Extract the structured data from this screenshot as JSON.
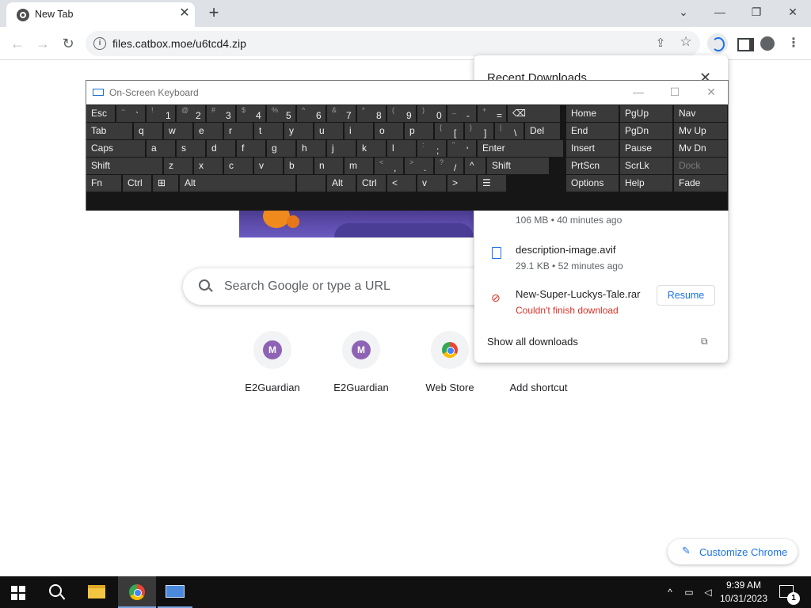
{
  "tab": {
    "title": "New Tab",
    "close_glyph": "✕"
  },
  "newtab_glyph": "+",
  "window_controls": {
    "tab_search": "⌄",
    "minimize": "—",
    "restore": "❐",
    "close": "✕"
  },
  "toolbar": {
    "back_glyph": "←",
    "forward_glyph": "→",
    "reload_glyph": "↻",
    "url": "files.catbox.moe/u6tcd4.zip",
    "info_glyph": "i",
    "share_glyph": "⇪",
    "star_glyph": "☆",
    "menu_glyph": "⋮"
  },
  "ntp": {
    "search_placeholder": "Search Google or type a URL",
    "shortcuts": [
      {
        "letter": "M",
        "label": "E2Guardian"
      },
      {
        "letter": "M",
        "label": "E2Guardian"
      },
      {
        "label": "Web Store"
      },
      {
        "label": "Add shortcut"
      }
    ],
    "customize_label": "Customize Chrome",
    "pencil_glyph": "✎"
  },
  "downloads": {
    "title": "Recent Downloads",
    "close_glyph": "✕",
    "items": [
      {
        "name": "",
        "meta": "106 MB • 40 minutes ago"
      },
      {
        "name": "description-image.avif",
        "meta": "29.1 KB • 52 minutes ago"
      },
      {
        "name": "New-Super-Luckys-Tale.rar",
        "meta": "Couldn't finish download",
        "action": "Resume"
      }
    ],
    "show_all": "Show all downloads",
    "external_glyph": "⧉"
  },
  "osk": {
    "title": "On-Screen Keyboard",
    "controls": {
      "minimize": "—",
      "maximize": "☐",
      "close": "✕"
    },
    "row1": [
      {
        "main": "Esc"
      },
      {
        "shift": "~",
        "main": "`"
      },
      {
        "shift": "!",
        "main": "1"
      },
      {
        "shift": "@",
        "main": "2"
      },
      {
        "shift": "#",
        "main": "3"
      },
      {
        "shift": "$",
        "main": "4"
      },
      {
        "shift": "%",
        "main": "5"
      },
      {
        "shift": "^",
        "main": "6"
      },
      {
        "shift": "&",
        "main": "7"
      },
      {
        "shift": "*",
        "main": "8"
      },
      {
        "shift": "(",
        "main": "9"
      },
      {
        "shift": ")",
        "main": "0"
      },
      {
        "shift": "_",
        "main": "-"
      },
      {
        "shift": "+",
        "main": "="
      },
      {
        "main": "⌫"
      }
    ],
    "row2": [
      {
        "main": "Tab"
      },
      {
        "main": "q"
      },
      {
        "main": "w"
      },
      {
        "main": "e"
      },
      {
        "main": "r"
      },
      {
        "main": "t"
      },
      {
        "main": "y"
      },
      {
        "main": "u"
      },
      {
        "main": "i"
      },
      {
        "main": "o"
      },
      {
        "main": "p"
      },
      {
        "shift": "{",
        "main": "["
      },
      {
        "shift": "}",
        "main": "]"
      },
      {
        "shift": "|",
        "main": "\\"
      },
      {
        "main": "Del"
      }
    ],
    "row3": [
      {
        "main": "Caps"
      },
      {
        "main": "a"
      },
      {
        "main": "s"
      },
      {
        "main": "d"
      },
      {
        "main": "f"
      },
      {
        "main": "g"
      },
      {
        "main": "h"
      },
      {
        "main": "j"
      },
      {
        "main": "k"
      },
      {
        "main": "l"
      },
      {
        "shift": ":",
        "main": ";"
      },
      {
        "shift": "\"",
        "main": "'"
      },
      {
        "main": "Enter"
      }
    ],
    "row4": [
      {
        "main": "Shift"
      },
      {
        "main": "z"
      },
      {
        "main": "x"
      },
      {
        "main": "c"
      },
      {
        "main": "v"
      },
      {
        "main": "b"
      },
      {
        "main": "n"
      },
      {
        "main": "m"
      },
      {
        "shift": "<",
        "main": ","
      },
      {
        "shift": ">",
        "main": "."
      },
      {
        "shift": "?",
        "main": "/"
      },
      {
        "main": "^"
      },
      {
        "main": "Shift"
      }
    ],
    "row5": [
      {
        "main": "Fn"
      },
      {
        "main": "Ctrl"
      },
      {
        "main": "⊞"
      },
      {
        "main": "Alt"
      },
      {
        "main": ""
      },
      {
        "main": "Alt"
      },
      {
        "main": "Ctrl"
      },
      {
        "main": "<"
      },
      {
        "main": "v"
      },
      {
        "main": ">"
      },
      {
        "main": "☰"
      }
    ],
    "nav_keys": [
      [
        "Home",
        "PgUp",
        "Nav"
      ],
      [
        "End",
        "PgDn",
        "Mv Up"
      ],
      [
        "Insert",
        "Pause",
        "Mv Dn"
      ],
      [
        "PrtScn",
        "ScrLk",
        "Dock"
      ],
      [
        "Options",
        "Help",
        "Fade"
      ]
    ]
  },
  "taskbar": {
    "time": "9:39 AM",
    "date": "10/31/2023",
    "notification_count": "1",
    "tray_chevron": "^"
  }
}
